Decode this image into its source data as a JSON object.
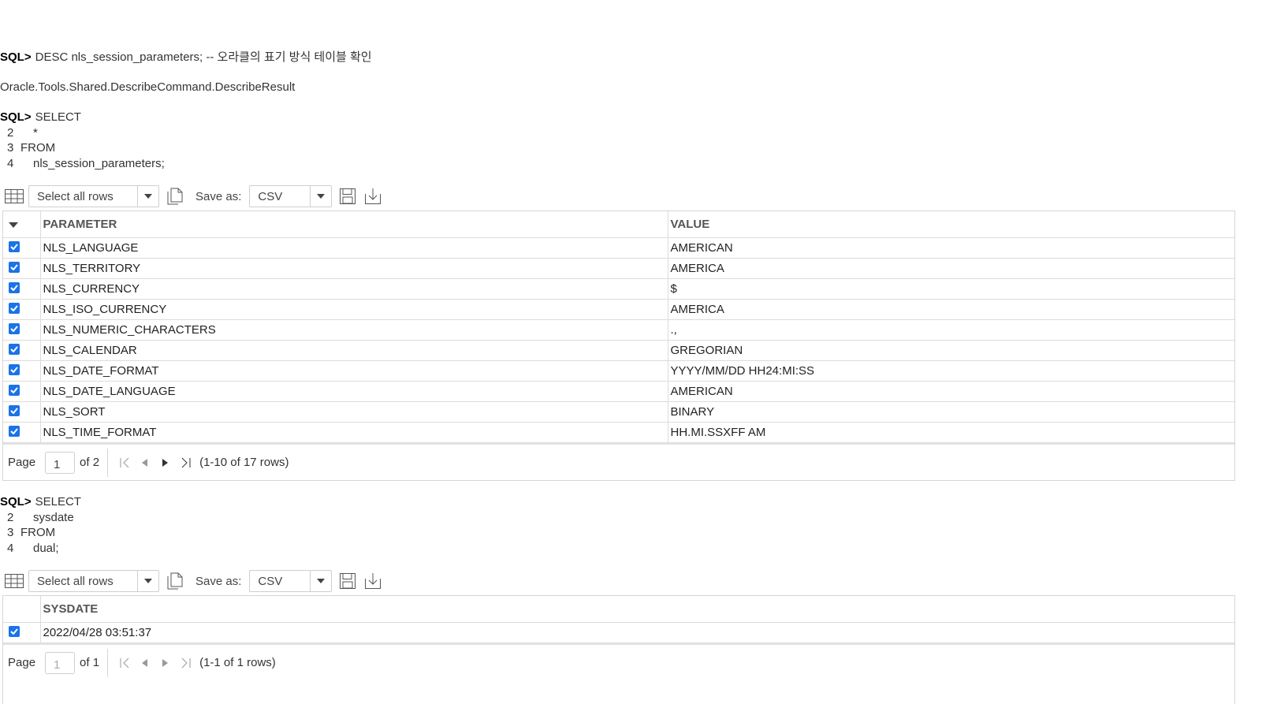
{
  "prompt": "SQL>",
  "cmd1": {
    "text": "DESC nls_session_parameters; -- 오라클의 표기 방식 테이블 확인",
    "result": "Oracle.Tools.Shared.DescribeCommand.DescribeResult"
  },
  "query1": {
    "line1": "SELECT",
    "lines": [
      {
        "num": "2",
        "text": "*"
      },
      {
        "num": "3",
        "text": "FROM"
      },
      {
        "num": "4",
        "text": "nls_session_parameters;"
      }
    ]
  },
  "toolbar1": {
    "select_rows": "Select all rows",
    "save_as": "Save as:",
    "format": "CSV"
  },
  "grid1": {
    "columns": [
      "PARAMETER",
      "VALUE"
    ],
    "rows": [
      [
        "NLS_LANGUAGE",
        "AMERICAN"
      ],
      [
        "NLS_TERRITORY",
        "AMERICA"
      ],
      [
        "NLS_CURRENCY",
        "$"
      ],
      [
        "NLS_ISO_CURRENCY",
        "AMERICA"
      ],
      [
        "NLS_NUMERIC_CHARACTERS",
        ".,"
      ],
      [
        "NLS_CALENDAR",
        "GREGORIAN"
      ],
      [
        "NLS_DATE_FORMAT",
        "YYYY/MM/DD HH24:MI:SS"
      ],
      [
        "NLS_DATE_LANGUAGE",
        "AMERICAN"
      ],
      [
        "NLS_SORT",
        "BINARY"
      ],
      [
        "NLS_TIME_FORMAT",
        "HH.MI.SSXFF AM"
      ]
    ],
    "pager": {
      "page_label": "Page",
      "page": "1",
      "of": "of 2",
      "rows_info": "(1-10 of 17 rows)"
    }
  },
  "query2": {
    "line1": "SELECT",
    "lines": [
      {
        "num": "2",
        "text": "sysdate"
      },
      {
        "num": "3",
        "text": "FROM"
      },
      {
        "num": "4",
        "text": "dual;"
      }
    ]
  },
  "toolbar2": {
    "select_rows": "Select all rows",
    "save_as": "Save as:",
    "format": "CSV"
  },
  "grid2": {
    "columns": [
      "SYSDATE"
    ],
    "rows": [
      [
        "2022/04/28 03:51:37"
      ]
    ],
    "pager": {
      "page_label": "Page",
      "page": "1",
      "of": "of 1",
      "rows_info": "(1-1 of 1 rows)"
    }
  }
}
